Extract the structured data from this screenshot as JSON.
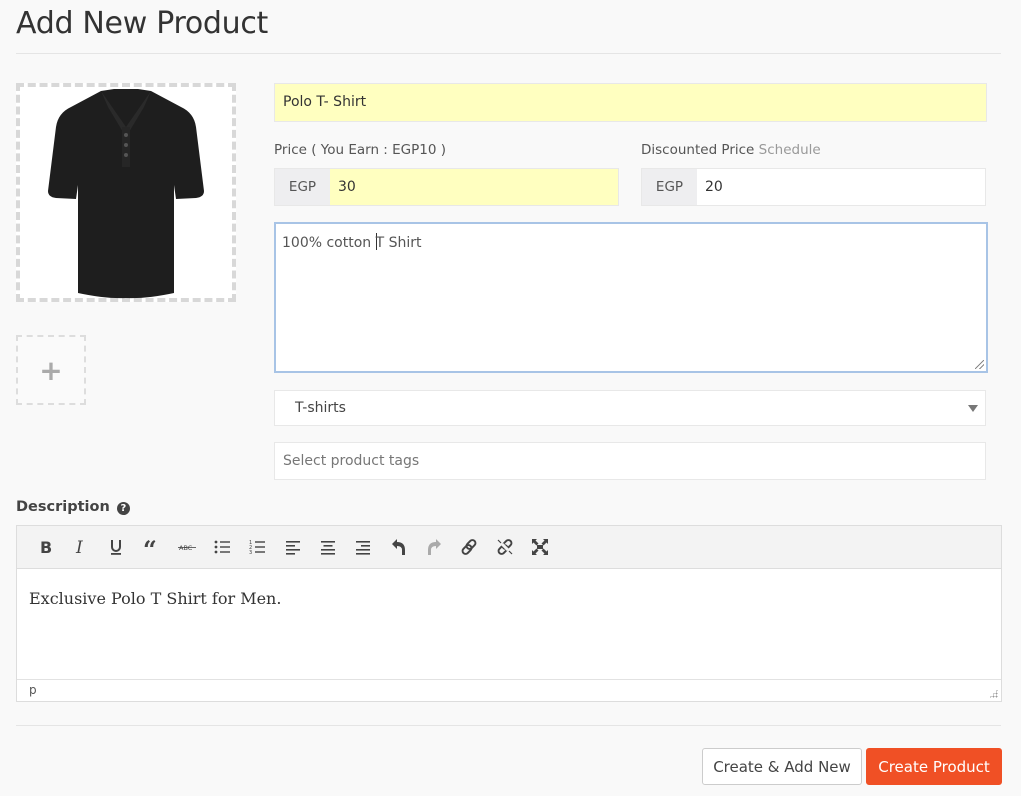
{
  "page": {
    "title": "Add New Product"
  },
  "product_image": {
    "alt": "Black polo t-shirt",
    "add_icon": "plus-icon"
  },
  "form": {
    "name": {
      "value": "Polo T- Shirt"
    },
    "price": {
      "label": "Price ( You Earn : EGP10 )",
      "currency": "EGP",
      "value": "30"
    },
    "discounted_price": {
      "label": "Discounted Price",
      "schedule_link": "Schedule",
      "currency": "EGP",
      "value": "20"
    },
    "short_description": {
      "before_caret": "100% cotton ",
      "after_caret": "T Shirt"
    },
    "category": {
      "selected": "T-shirts"
    },
    "tags": {
      "placeholder": "Select product tags"
    }
  },
  "description": {
    "label": "Description",
    "help_icon": "question-circle-icon",
    "toolbar": [
      {
        "name": "bold",
        "icon": "bold-icon"
      },
      {
        "name": "italic",
        "icon": "italic-icon"
      },
      {
        "name": "underline",
        "icon": "underline-icon"
      },
      {
        "name": "blockquote",
        "icon": "quote-icon"
      },
      {
        "name": "strikethrough",
        "icon": "strikethrough-icon"
      },
      {
        "name": "bullet-list",
        "icon": "bullet-list-icon"
      },
      {
        "name": "numbered-list",
        "icon": "numbered-list-icon"
      },
      {
        "name": "align-left",
        "icon": "align-left-icon"
      },
      {
        "name": "align-center",
        "icon": "align-center-icon"
      },
      {
        "name": "align-right",
        "icon": "align-right-icon"
      },
      {
        "name": "undo",
        "icon": "undo-icon"
      },
      {
        "name": "redo",
        "icon": "redo-icon",
        "disabled": true
      },
      {
        "name": "link",
        "icon": "link-icon"
      },
      {
        "name": "unlink",
        "icon": "unlink-icon"
      },
      {
        "name": "fullscreen",
        "icon": "fullscreen-icon"
      }
    ],
    "content": "Exclusive Polo T Shirt for Men.",
    "status_path": "p"
  },
  "actions": {
    "create_add_new": "Create & Add New",
    "create_product": "Create Product",
    "primary_color": "#f05025"
  }
}
